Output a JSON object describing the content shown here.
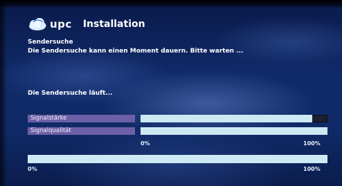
{
  "header": {
    "brand": "upc",
    "title": "Installation",
    "logo_icon": "upc-cloud-logo"
  },
  "section_title": "Sendersuche",
  "instructions": "Die Sendersuche kann einen Moment dauern. Bitte warten ...",
  "status": "Die Sendersuche läuft...",
  "meters": [
    {
      "label": "Signalstärke",
      "value": 0.92
    },
    {
      "label": "Signalqualität",
      "value": 1.0
    }
  ],
  "meter_scale": {
    "min": "0%",
    "max": "100%"
  },
  "progress": {
    "value": 1.0,
    "min": "0%",
    "max": "100%"
  },
  "colors": {
    "label_bg": "#6d5fa6",
    "bar_fill": "#cde9f4",
    "bar_track": "#1b1f2e",
    "background": "#0f2a66"
  }
}
